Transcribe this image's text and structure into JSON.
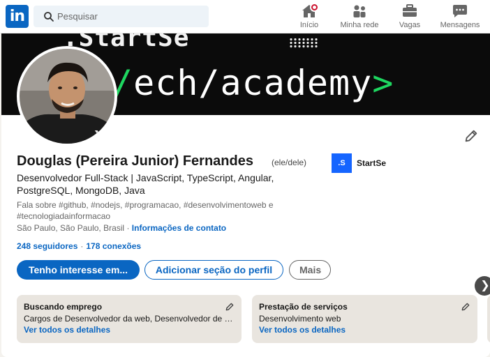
{
  "nav": {
    "logo_text": "in",
    "search_placeholder": "Pesquisar",
    "items": [
      {
        "label": "Início",
        "icon": "home-icon"
      },
      {
        "label": "Minha rede",
        "icon": "people-icon"
      },
      {
        "label": "Vagas",
        "icon": "briefcase-icon"
      },
      {
        "label": "Mensagens",
        "icon": "message-icon"
      }
    ]
  },
  "cover": {
    "top_text": ".StartSe",
    "main_slash": "/",
    "main_word": "ech/academy",
    "main_suffix": ">"
  },
  "profile": {
    "name": "Douglas (Pereira Junior) Fernandes",
    "pronouns": "(ele/dele)",
    "headline": "Desenvolvedor Full-Stack | JavaScript, TypeScript, Angular, PostgreSQL, MongoDB, Java",
    "talks_about": "Fala sobre #github, #nodejs, #programacao, #desenvolvimentoweb e #tecnologiadainformacao",
    "location": "São Paulo, São Paulo, Brasil",
    "location_sep": " · ",
    "contact_link": "Informações de contato",
    "followers": "248 seguidores",
    "network_sep": "·",
    "connections": "178 conexões",
    "company_logo_text": ".S",
    "company_name": "StartSe"
  },
  "actions": {
    "open_to": "Tenho interesse em...",
    "add_section": "Adicionar seção do perfil",
    "more": "Mais"
  },
  "boxes": [
    {
      "title": "Buscando emprego",
      "text": "Cargos de Desenvolvedor da web, Desenvolvedor de software",
      "link": "Ver todos os detalhes"
    },
    {
      "title": "Prestação de serviços",
      "text": "Desenvolvimento web",
      "link": "Ver todos os detalhes"
    }
  ],
  "carousel_next": "❯",
  "colors": {
    "brand": "#0a66c2",
    "notification": "#cb112d",
    "cover_accent": "#1ed760",
    "company_logo": "#1565ff"
  }
}
